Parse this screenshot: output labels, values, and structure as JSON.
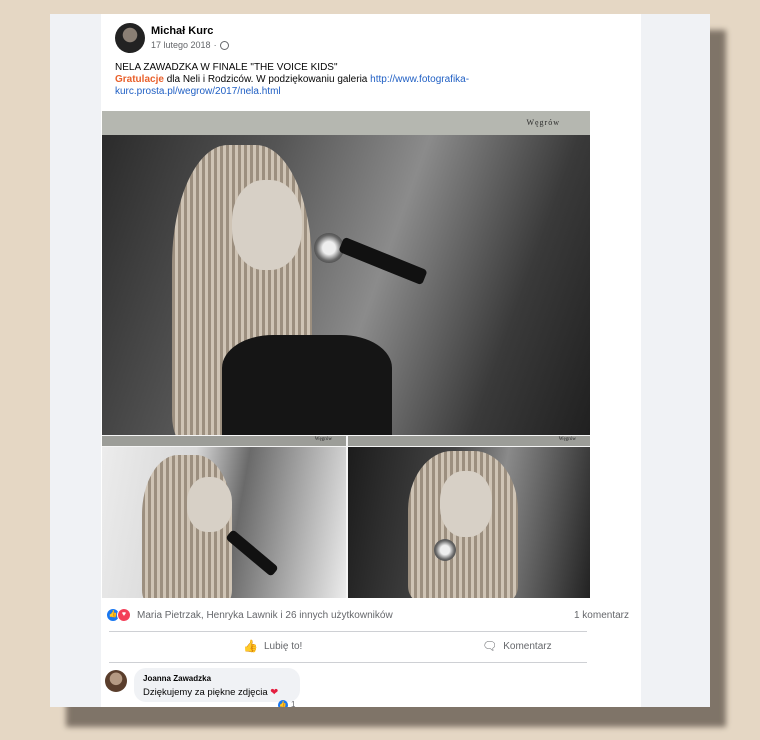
{
  "post": {
    "author": "Michał Kurc",
    "date": "17 lutego 2018",
    "privacy_icon": "globe-icon",
    "title_line": "NELA ZAWADZKA W FINALE \"THE VOICE KIDS\"",
    "highlight_word": "Gratulacje",
    "body_text": " dla Neli i Rodziców. W podziękowaniu galeria ",
    "link_text": "http://www.fotografika-kurc.prosta.pl/wegrow/2017/nela.html"
  },
  "gallery": {
    "watermark_big": "Węgrów",
    "watermark_small_1": "Węgrów",
    "watermark_small_2": "Węgrów"
  },
  "reactions": {
    "icons": [
      "like-icon",
      "love-icon"
    ],
    "summary": "Maria Pietrzak, Henryka Lawnik i 26 innych użytkowników",
    "comments_count": "1 komentarz"
  },
  "actions": {
    "like_label": "Lubię to!",
    "comment_label": "Komentarz"
  },
  "comment": {
    "author": "Joanna Zawadzka",
    "text": "Dziękujemy za piękne zdjęcia",
    "emoji": "❤",
    "like_count": "1"
  },
  "colors": {
    "accent_link": "#2160c4",
    "highlight": "#e9612c",
    "like_blue": "#1877f2",
    "love_red": "#f33e58"
  }
}
